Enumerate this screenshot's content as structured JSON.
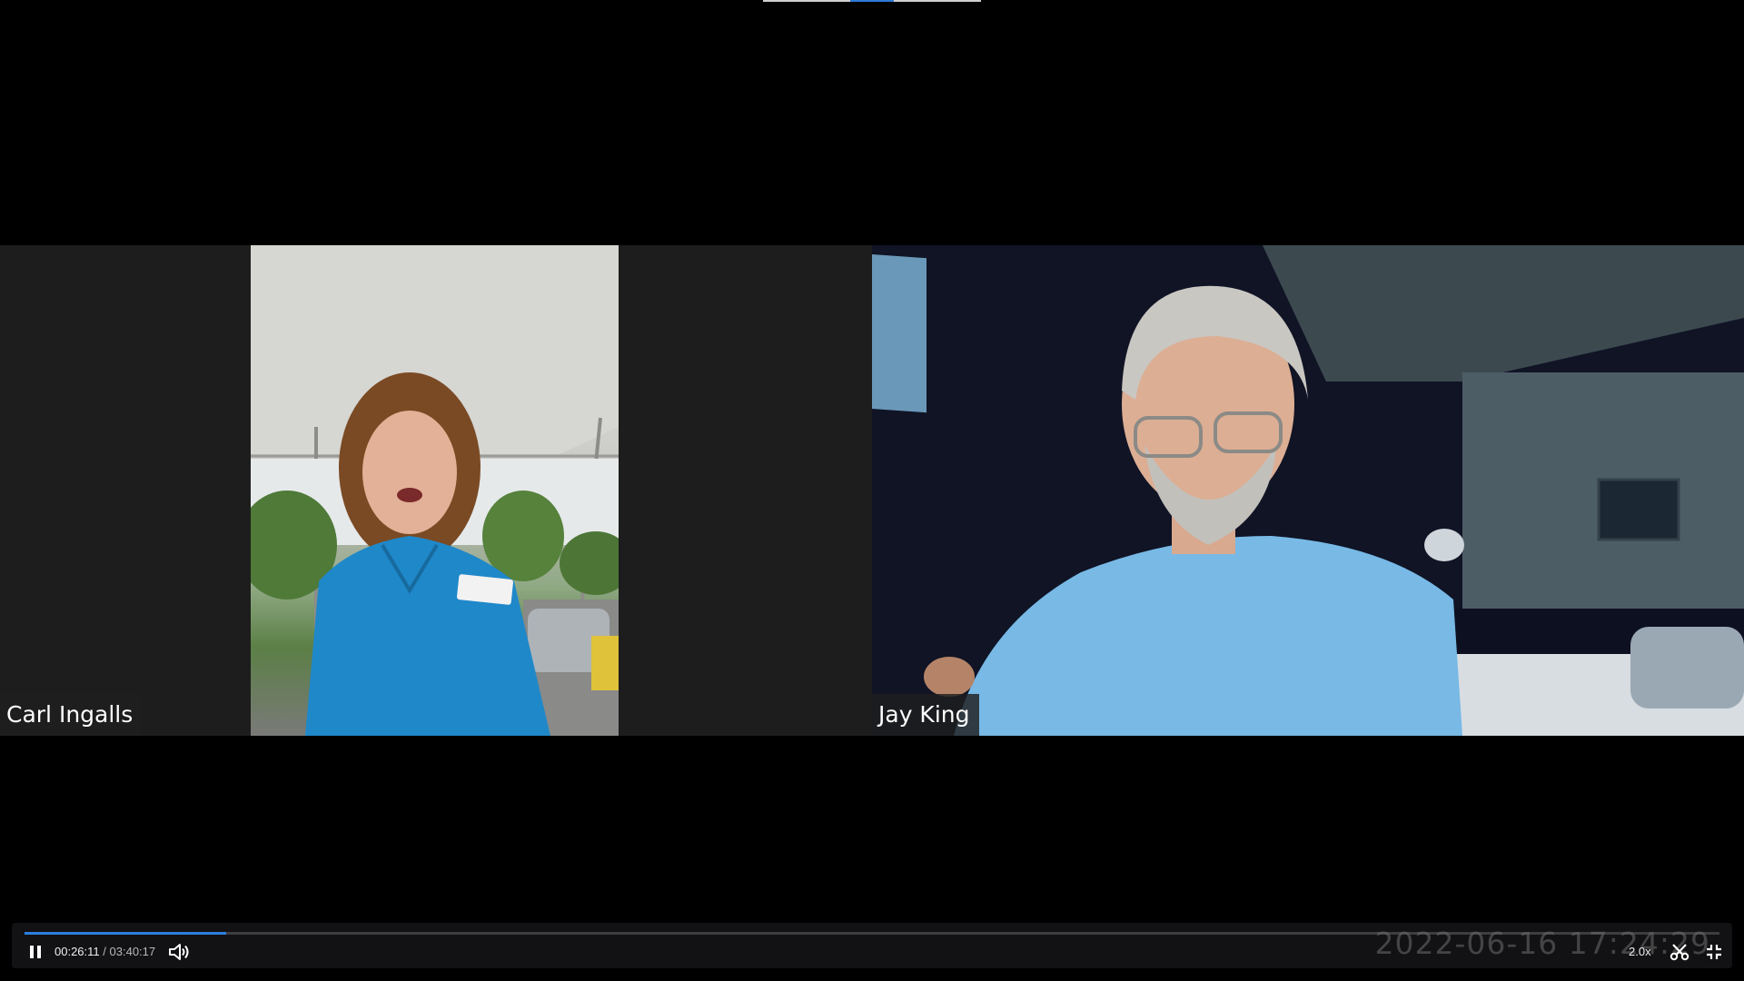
{
  "participants": [
    {
      "name": "Carl Ingalls"
    },
    {
      "name": "Jay King"
    }
  ],
  "player": {
    "current_time": "00:26:11",
    "separator": "/",
    "total_time": "03:40:17",
    "progress_fraction": 0.1189,
    "watermark_timestamp": "2022-06-16  17:24:29",
    "speed_label": "2.0x",
    "state": "playing"
  },
  "icons": {
    "play_pause": "pause-icon",
    "volume": "volume-icon",
    "clip": "scissors-icon",
    "exit_fullscreen": "exit-fullscreen-icon"
  },
  "colors": {
    "accent": "#2b7fe0",
    "background": "#000000",
    "tile_background": "#1d1d1d"
  }
}
